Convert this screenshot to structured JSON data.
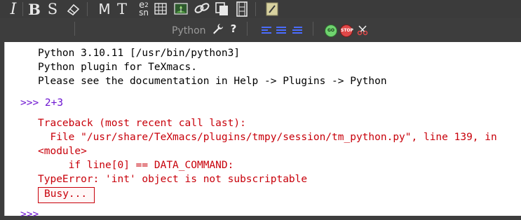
{
  "toolbar_format": {
    "italic": "I",
    "bold": "B",
    "strike": "S",
    "math": "M",
    "text": "T",
    "fraction_top": "e",
    "fraction_sub": "2",
    "fraction_bottom": "sn",
    "icons": [
      "italic-icon",
      "bold-icon",
      "strike-icon",
      "eraser-icon",
      "math-icon",
      "text-icon",
      "fraction-icon",
      "table-icon",
      "image-icon",
      "link-icon",
      "copy-icon",
      "film-icon",
      "note-icon"
    ]
  },
  "toolbar_session": {
    "plugin_name": "Python",
    "colors": {
      "blue_accent": "#4a6cff",
      "green": "#6fd36f",
      "red": "#e04848"
    },
    "icons": [
      "move-top-icon",
      "move-up-icon",
      "move-down-icon",
      "move-bottom-icon",
      "insert-above-icon",
      "insert-below-icon",
      "delete-above-icon",
      "delete-below-icon",
      "wrench-icon",
      "help-icon",
      "align-left-icon",
      "align-center-icon",
      "align-right-icon",
      "go-icon",
      "stop-icon",
      "scissors-icon"
    ]
  },
  "session": {
    "banner": [
      "Python 3.10.11 [/usr/bin/python3]",
      "Python plugin for TeXmacs.",
      "Please see the documentation in Help -> Plugins -> Python"
    ],
    "prompt": ">>> 2+3",
    "error": [
      "Traceback (most recent call last):",
      "  File \"/usr/share/TeXmacs/plugins/tmpy/session/tm_python.py\", line 139, in",
      "<module>",
      "     if line[0] == DATA_COMMAND:",
      "TypeError: 'int' object is not subscriptable"
    ],
    "status": "Busy...",
    "next_prompt": ">>> "
  },
  "colors": {
    "prompt": "#6d14d1",
    "error": "#c8000a",
    "toolbar_bg": "#3b3b3b"
  }
}
